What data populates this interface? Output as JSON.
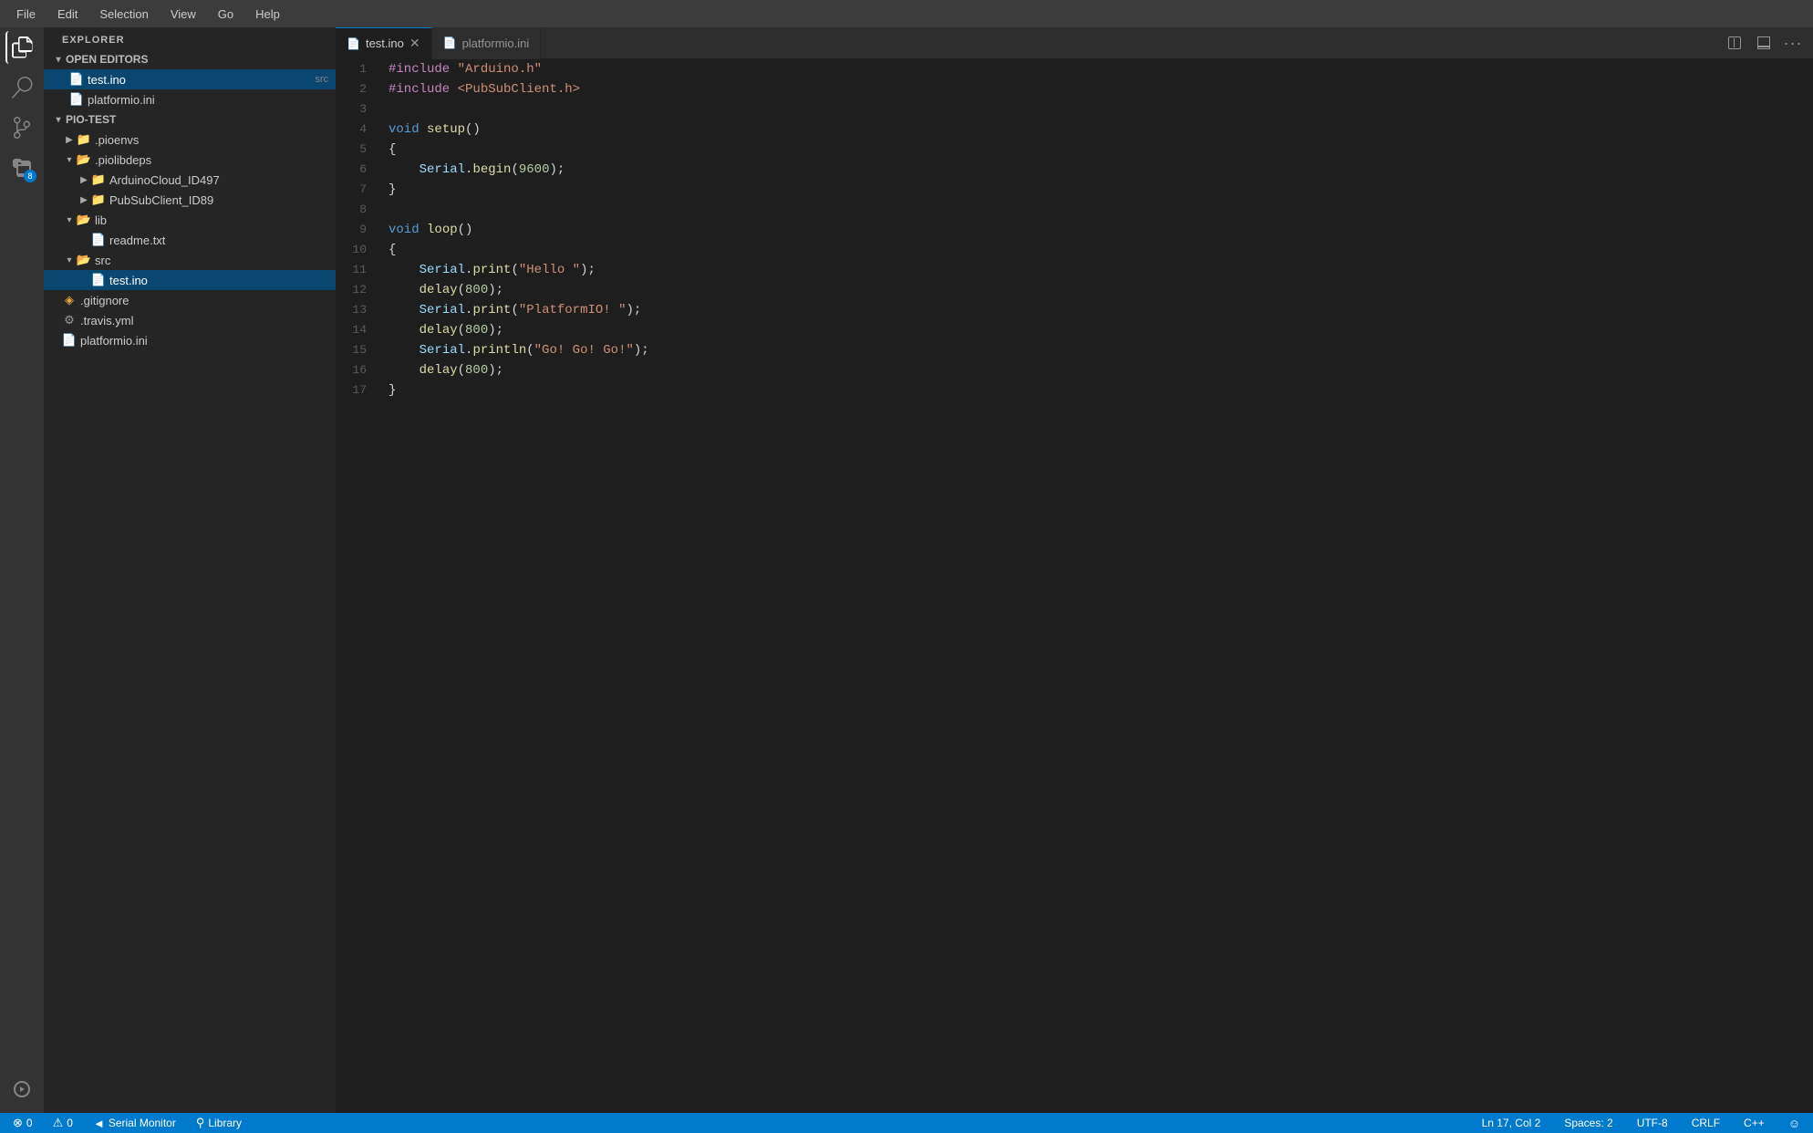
{
  "menubar": {
    "items": [
      "File",
      "Edit",
      "Selection",
      "View",
      "Go",
      "Help"
    ]
  },
  "activity_bar": {
    "icons": [
      {
        "name": "explorer-icon",
        "symbol": "⎘",
        "active": true,
        "badge": null
      },
      {
        "name": "search-icon",
        "symbol": "🔍",
        "active": false,
        "badge": null
      },
      {
        "name": "source-control-icon",
        "symbol": "⑂",
        "active": false,
        "badge": null
      },
      {
        "name": "extensions-icon",
        "symbol": "⊞",
        "active": false,
        "badge": "8"
      }
    ]
  },
  "sidebar": {
    "title": "EXPLORER",
    "sections": {
      "open_editors": {
        "label": "OPEN EDITORS",
        "files": [
          {
            "name": "test.ino",
            "tag": "src",
            "active": true
          },
          {
            "name": "platformio.ini",
            "tag": "",
            "active": false
          }
        ]
      },
      "project": {
        "label": "PIO-TEST",
        "items": [
          {
            "name": ".pioenvs",
            "type": "folder",
            "indent": 1
          },
          {
            "name": ".piolibdeps",
            "type": "folder",
            "indent": 1,
            "expanded": true
          },
          {
            "name": "ArduinoCloud_ID497",
            "type": "folder",
            "indent": 2
          },
          {
            "name": "PubSubClient_ID89",
            "type": "folder",
            "indent": 2
          },
          {
            "name": "lib",
            "type": "folder",
            "indent": 1,
            "expanded": true
          },
          {
            "name": "readme.txt",
            "type": "file",
            "indent": 2
          },
          {
            "name": "src",
            "type": "folder",
            "indent": 1,
            "expanded": true
          },
          {
            "name": "test.ino",
            "type": "file",
            "indent": 3,
            "highlighted": true
          },
          {
            "name": ".gitignore",
            "type": "gitignore",
            "indent": 1
          },
          {
            "name": ".travis.yml",
            "type": "travis",
            "indent": 1
          },
          {
            "name": "platformio.ini",
            "type": "file",
            "indent": 1
          }
        ]
      }
    }
  },
  "tabs": [
    {
      "name": "test.ino",
      "active": true,
      "closeable": true
    },
    {
      "name": "platformio.ini",
      "active": false,
      "closeable": false
    }
  ],
  "code": {
    "lines": [
      {
        "num": 1,
        "tokens": [
          {
            "t": "inc",
            "v": "#include"
          },
          {
            "t": "plain",
            "v": " "
          },
          {
            "t": "incfile",
            "v": "\"Arduino.h\""
          }
        ]
      },
      {
        "num": 2,
        "tokens": [
          {
            "t": "inc",
            "v": "#include"
          },
          {
            "t": "plain",
            "v": " "
          },
          {
            "t": "incfile",
            "v": "<PubSubClient.h>"
          }
        ]
      },
      {
        "num": 3,
        "tokens": []
      },
      {
        "num": 4,
        "tokens": [
          {
            "t": "kw",
            "v": "void"
          },
          {
            "t": "plain",
            "v": " "
          },
          {
            "t": "fn",
            "v": "setup"
          },
          {
            "t": "plain",
            "v": "()"
          }
        ]
      },
      {
        "num": 5,
        "tokens": [
          {
            "t": "bracket",
            "v": "{"
          }
        ]
      },
      {
        "num": 6,
        "tokens": [
          {
            "t": "plain",
            "v": "    "
          },
          {
            "t": "member",
            "v": "Serial"
          },
          {
            "t": "plain",
            "v": "."
          },
          {
            "t": "fn",
            "v": "begin"
          },
          {
            "t": "plain",
            "v": "("
          },
          {
            "t": "num",
            "v": "9600"
          },
          {
            "t": "plain",
            "v": ");"
          }
        ]
      },
      {
        "num": 7,
        "tokens": [
          {
            "t": "bracket",
            "v": "}"
          }
        ]
      },
      {
        "num": 8,
        "tokens": []
      },
      {
        "num": 9,
        "tokens": [
          {
            "t": "kw",
            "v": "void"
          },
          {
            "t": "plain",
            "v": " "
          },
          {
            "t": "fn",
            "v": "loop"
          },
          {
            "t": "plain",
            "v": "()"
          }
        ]
      },
      {
        "num": 10,
        "tokens": [
          {
            "t": "bracket",
            "v": "{"
          }
        ]
      },
      {
        "num": 11,
        "tokens": [
          {
            "t": "plain",
            "v": "    "
          },
          {
            "t": "member",
            "v": "Serial"
          },
          {
            "t": "plain",
            "v": "."
          },
          {
            "t": "fn",
            "v": "print"
          },
          {
            "t": "plain",
            "v": "("
          },
          {
            "t": "str",
            "v": "\"Hello \""
          },
          {
            "t": "plain",
            "v": ");"
          }
        ]
      },
      {
        "num": 12,
        "tokens": [
          {
            "t": "plain",
            "v": "    "
          },
          {
            "t": "fn",
            "v": "delay"
          },
          {
            "t": "plain",
            "v": "("
          },
          {
            "t": "num",
            "v": "800"
          },
          {
            "t": "plain",
            "v": ");"
          }
        ]
      },
      {
        "num": 13,
        "tokens": [
          {
            "t": "plain",
            "v": "    "
          },
          {
            "t": "member",
            "v": "Serial"
          },
          {
            "t": "plain",
            "v": "."
          },
          {
            "t": "fn",
            "v": "print"
          },
          {
            "t": "plain",
            "v": "("
          },
          {
            "t": "str",
            "v": "\"PlatformIO! \""
          },
          {
            "t": "plain",
            "v": ");"
          }
        ]
      },
      {
        "num": 14,
        "tokens": [
          {
            "t": "plain",
            "v": "    "
          },
          {
            "t": "fn",
            "v": "delay"
          },
          {
            "t": "plain",
            "v": "("
          },
          {
            "t": "num",
            "v": "800"
          },
          {
            "t": "plain",
            "v": ");"
          }
        ]
      },
      {
        "num": 15,
        "tokens": [
          {
            "t": "plain",
            "v": "    "
          },
          {
            "t": "member",
            "v": "Serial"
          },
          {
            "t": "plain",
            "v": "."
          },
          {
            "t": "fn",
            "v": "println"
          },
          {
            "t": "plain",
            "v": "("
          },
          {
            "t": "str",
            "v": "\"Go! Go! Go!\""
          },
          {
            "t": "plain",
            "v": ");"
          }
        ]
      },
      {
        "num": 16,
        "tokens": [
          {
            "t": "plain",
            "v": "    "
          },
          {
            "t": "fn",
            "v": "delay"
          },
          {
            "t": "plain",
            "v": "("
          },
          {
            "t": "num",
            "v": "800"
          },
          {
            "t": "plain",
            "v": ");"
          }
        ]
      },
      {
        "num": 17,
        "tokens": [
          {
            "t": "bracket",
            "v": "}"
          }
        ]
      }
    ]
  },
  "statusbar": {
    "left": [
      {
        "icon": "⊗",
        "label": "0",
        "type": "error"
      },
      {
        "icon": "⚠",
        "label": "0",
        "type": "warning"
      },
      {
        "icon": "◄",
        "label": "Serial Monitor"
      },
      {
        "icon": "⚲",
        "label": "Library"
      }
    ],
    "right": [
      {
        "label": "Ln 17, Col 2"
      },
      {
        "label": "Spaces: 2"
      },
      {
        "label": "UTF-8"
      },
      {
        "label": "CRLF"
      },
      {
        "label": "C++"
      },
      {
        "icon": "☺",
        "label": ""
      }
    ]
  }
}
